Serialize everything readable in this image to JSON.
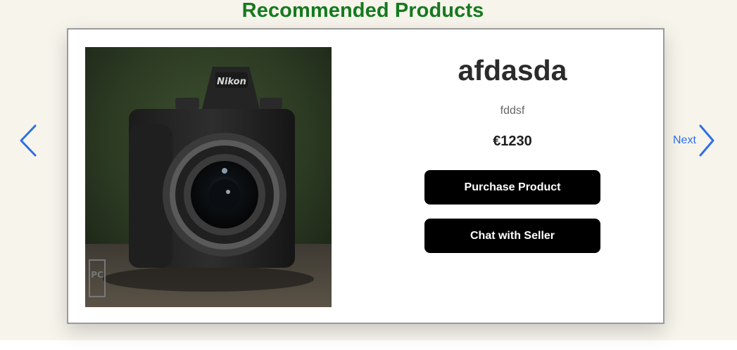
{
  "section": {
    "title": "Recommended Products"
  },
  "carousel": {
    "prev_icon": "chevron-left-icon",
    "next_label": "Next",
    "next_icon": "chevron-right-icon",
    "accent_color": "#2d6fe6"
  },
  "product": {
    "name": "afdasda",
    "description": "fddsf",
    "price": "€1230",
    "image_icon": "camera-photo",
    "image_watermark": "PC"
  },
  "actions": {
    "purchase_label": "Purchase Product",
    "chat_label": "Chat with Seller"
  },
  "colors": {
    "title": "#157a1e",
    "background": "#f7f4ec",
    "button": "#000000"
  }
}
